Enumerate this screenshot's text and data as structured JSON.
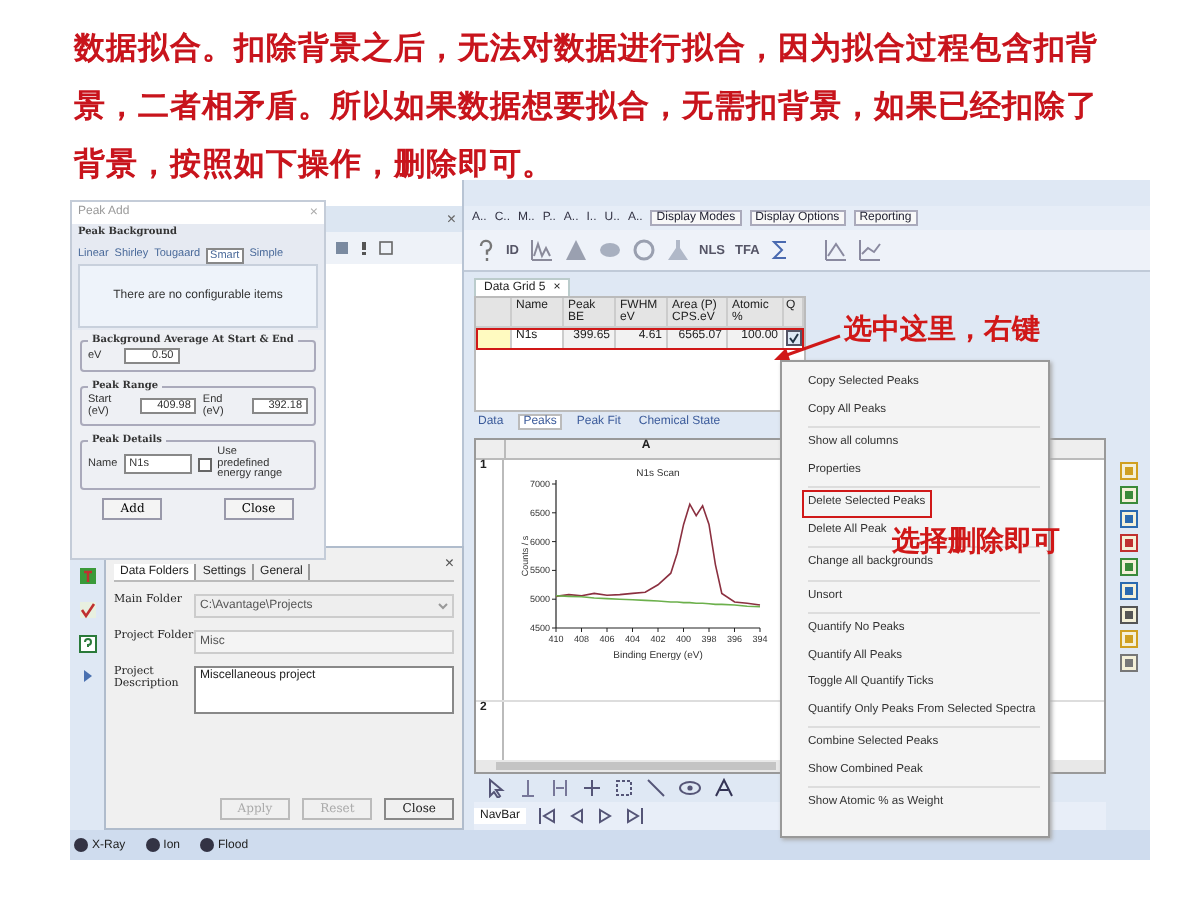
{
  "caption": "数据拟合。扣除背景之后，无法对数据进行拟合，因为拟合过程包含扣背景，二者相矛盾。所以如果数据想要拟合，无需扣背景，如果已经扣除了背景，按照如下操作，删除即可。",
  "main_window": {
    "side_panel": {
      "close": "×"
    },
    "toolbar_tabs": [
      "A..",
      "C..",
      "M..",
      "P..",
      "A..",
      "I..",
      "U..",
      "A.."
    ],
    "toolbar_buttons": [
      "ID",
      "NLS",
      "TFA"
    ],
    "menu_tabs": [
      "Display Modes",
      "Display Options",
      "Reporting"
    ],
    "document_tab": {
      "label": "Data Grid 5",
      "close": "×"
    },
    "grid": {
      "columns": [
        "Name",
        "Peak BE",
        "FWHM eV",
        "Area (P) CPS.eV",
        "Atomic %",
        "Q"
      ],
      "rows": [
        {
          "cells": [
            "N1s",
            "399.65",
            "4.61",
            "6565.07",
            "100.00"
          ],
          "quantify": true,
          "marked": true
        }
      ]
    },
    "grid_tabs": [
      {
        "label": "Data",
        "selected": false
      },
      {
        "label": "Peaks",
        "selected": true
      },
      {
        "label": "Peak Fit",
        "selected": false
      },
      {
        "label": "Chemical State",
        "selected": false
      }
    ],
    "chart_panel": {
      "column": "A",
      "rows": [
        "1",
        "2"
      ],
      "chart_data": {
        "type": "line",
        "title": "N1s Scan",
        "xlabel": "Binding Energy (eV)",
        "ylabel": "Counts / s",
        "x": [
          410,
          409,
          408,
          407,
          406,
          405,
          404,
          403,
          402,
          401,
          400.5,
          400,
          399.5,
          399,
          398.5,
          398,
          397.5,
          397,
          396,
          395,
          394
        ],
        "series": [
          {
            "color": "#8b3040",
            "values": [
              5050,
              5080,
              5060,
              5100,
              5070,
              5080,
              5100,
              5120,
              5250,
              5450,
              5800,
              6300,
              6650,
              6450,
              6620,
              6300,
              5600,
              5100,
              4950,
              4930,
              4900
            ]
          },
          {
            "color": "#6cb04c",
            "values": [
              5060,
              5050,
              5040,
              5020,
              5010,
              5000,
              4990,
              4980,
              4970,
              4950,
              4950,
              4940,
              4940,
              4930,
              4930,
              4920,
              4910,
              4910,
              4900,
              4880,
              4870
            ]
          }
        ],
        "xlim": [
          410,
          394
        ],
        "ylim": [
          4500,
          7000
        ],
        "xticks": [
          410,
          408,
          406,
          404,
          402,
          400,
          398,
          396,
          394
        ],
        "yticks": [
          4500,
          5000,
          5500,
          6000,
          6500,
          7000
        ]
      }
    },
    "navbar": {
      "label": "NavBar"
    },
    "settings_panel": {
      "close": "×",
      "tabs": [
        {
          "label": "Data Folders",
          "selected": true
        },
        {
          "label": "Settings",
          "selected": false
        },
        {
          "label": "General",
          "selected": false
        }
      ],
      "fields": [
        {
          "label": "Main Folder",
          "value": "C:\\Avantage\\Projects",
          "kind": "dropdown"
        },
        {
          "label": "Project Folder",
          "value": "Misc",
          "kind": "text"
        },
        {
          "label": "Project Description",
          "value": "Miscellaneous project",
          "kind": "textarea"
        }
      ],
      "buttons": [
        {
          "label": "Apply",
          "disabled": true
        },
        {
          "label": "Reset",
          "disabled": true
        },
        {
          "label": "Close",
          "disabled": false
        }
      ]
    },
    "status_bar": [
      "X-Ray",
      "Ion",
      "Flood"
    ]
  },
  "peak_add_dialog": {
    "title": "Peak Add",
    "close": "×",
    "background_group": "Peak Background",
    "tabs": [
      {
        "label": "Linear",
        "selected": false
      },
      {
        "label": "Shirley",
        "selected": false
      },
      {
        "label": "Tougaard",
        "selected": false
      },
      {
        "label": "Smart",
        "selected": true
      },
      {
        "label": "Simple",
        "selected": false
      }
    ],
    "message": "There are no configurable items",
    "average_group": "Background Average At Start & End",
    "ev_label": "eV",
    "ev_value": "0.50",
    "range_group": "Peak Range",
    "start_label": "Start (eV)",
    "start_value": "409.98",
    "end_label": "End (eV)",
    "end_value": "392.18",
    "details_group": "Peak Details",
    "name_label": "Name",
    "name_value": "N1s",
    "predefined": {
      "label": "Use predefined energy range",
      "checked": false
    },
    "buttons": [
      "Add",
      "Close"
    ]
  },
  "context_menu": {
    "groups": [
      [
        {
          "label": "Copy Selected Peaks",
          "marked": false
        },
        {
          "label": "Copy All Peaks",
          "marked": false
        }
      ],
      [
        {
          "label": "Show all columns",
          "marked": false
        },
        {
          "label": "Properties",
          "marked": false
        }
      ],
      [
        {
          "label": "Delete Selected Peaks",
          "marked": true
        },
        {
          "label": "Delete All Peak",
          "marked": false
        }
      ],
      [
        {
          "label": "Change all backgrounds",
          "marked": false
        }
      ],
      [
        {
          "label": "Unsort",
          "marked": false
        }
      ],
      [
        {
          "label": "Quantify No Peaks",
          "marked": false
        },
        {
          "label": "Quantify All Peaks",
          "marked": false
        },
        {
          "label": "Toggle All Quantify Ticks",
          "marked": false
        },
        {
          "label": "Quantify Only Peaks From Selected Spectra",
          "marked": false
        }
      ],
      [
        {
          "label": "Combine Selected Peaks",
          "marked": false
        },
        {
          "label": "Show Combined Peak",
          "marked": false
        }
      ],
      [
        {
          "label": "Show Atomic % as Weight",
          "marked": false
        }
      ]
    ]
  },
  "annotations": [
    {
      "text": "选中这里，右键"
    },
    {
      "text": "选择删除即可"
    }
  ]
}
